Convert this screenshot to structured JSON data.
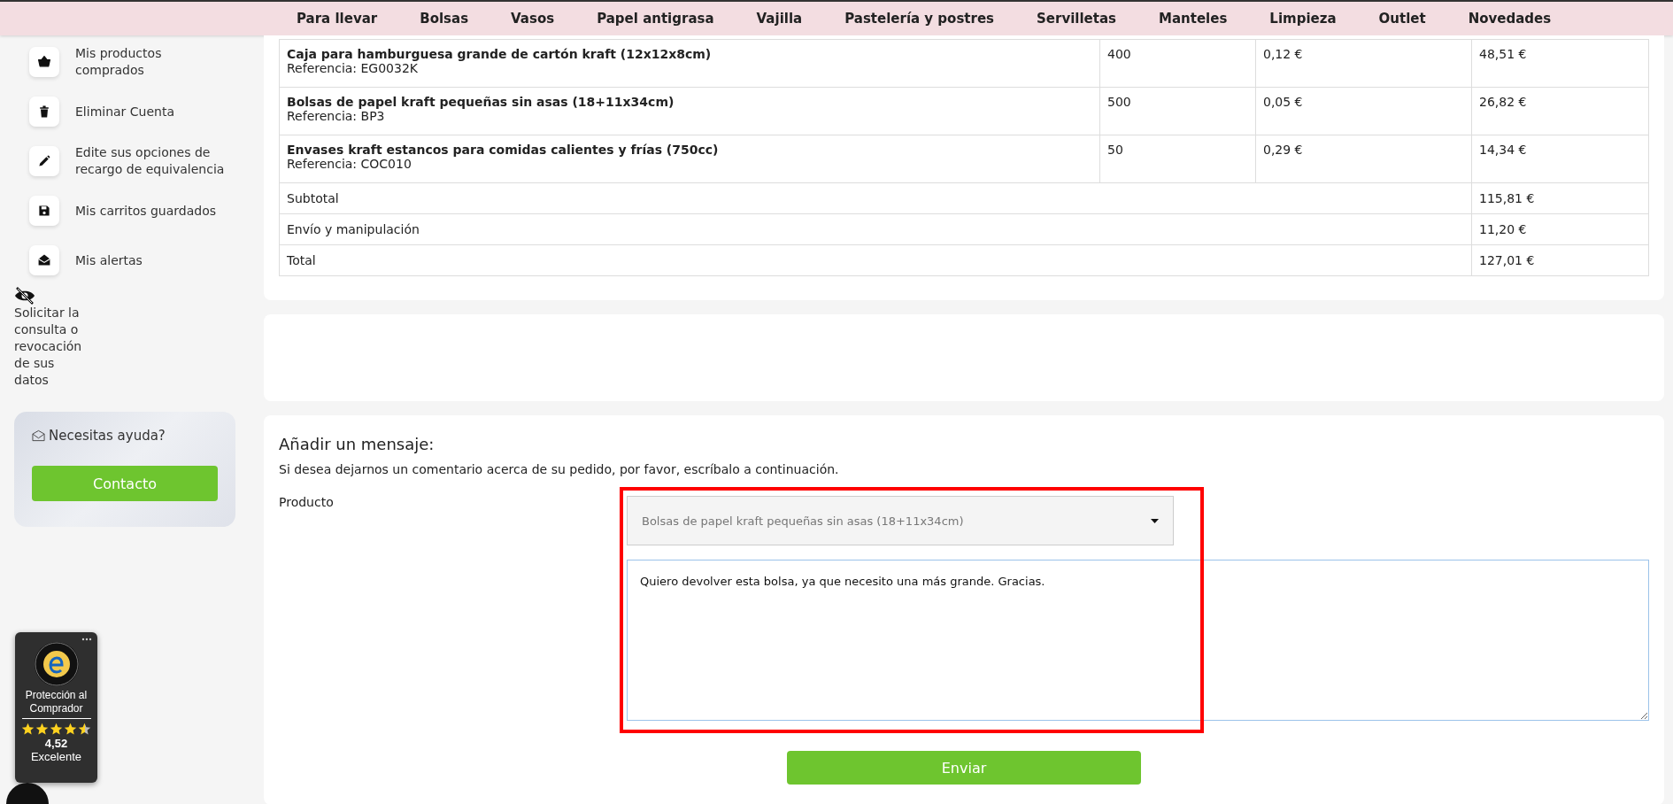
{
  "nav": [
    "Para llevar",
    "Bolsas",
    "Vasos",
    "Papel antigrasa",
    "Vajilla",
    "Pastelería y postres",
    "Servilletas",
    "Manteles",
    "Limpieza",
    "Outlet",
    "Novedades"
  ],
  "sidebar": {
    "items": [
      {
        "label": "Mis productos comprados"
      },
      {
        "label": "Eliminar Cuenta"
      },
      {
        "label": "Edite sus opciones de recargo de equivalencia"
      },
      {
        "label": "Mis carritos guardados"
      },
      {
        "label": "Mis alertas"
      }
    ],
    "privacy_link": "Solicitar la consulta o revocación de sus datos",
    "help": {
      "title": "Necesitas ayuda?",
      "button": "Contacto"
    }
  },
  "order_table": {
    "rows": [
      {
        "name": "Caja para hamburguesa grande de cartón kraft (12x12x8cm)",
        "reference": "Referencia: EG0032K",
        "quantity": "400",
        "unit_price": "0,12 €",
        "total": "48,51 €"
      },
      {
        "name": "Bolsas de papel kraft pequeñas sin asas (18+11x34cm)",
        "reference": "Referencia: BP3",
        "quantity": "500",
        "unit_price": "0,05 €",
        "total": "26,82 €"
      },
      {
        "name": "Envases kraft estancos para comidas calientes y frías (750cc)",
        "reference": "Referencia: COC010",
        "quantity": "50",
        "unit_price": "0,29 €",
        "total": "14,34 €"
      }
    ],
    "totals": [
      {
        "label": "Subtotal",
        "value": "115,81 €"
      },
      {
        "label": "Envío y manipulación",
        "value": "11,20 €"
      },
      {
        "label": "Total",
        "value": "127,01 €"
      }
    ]
  },
  "message": {
    "title": "Añadir un mensaje:",
    "hint": "Si desea dejarnos un comentario acerca de su pedido, por favor, escríbalo a continuación.",
    "product_label": "Producto",
    "product_value": "Bolsas de papel kraft pequeñas sin asas (18+11x34cm)",
    "text": "Quiero devolver esta bolsa, ya que necesito una más grande. Gracias.",
    "submit": "Enviar"
  },
  "trust_badge": {
    "title": "Protección al Comprador",
    "stars": 4.5,
    "rating": "4,52",
    "verdict": "Excelente"
  }
}
